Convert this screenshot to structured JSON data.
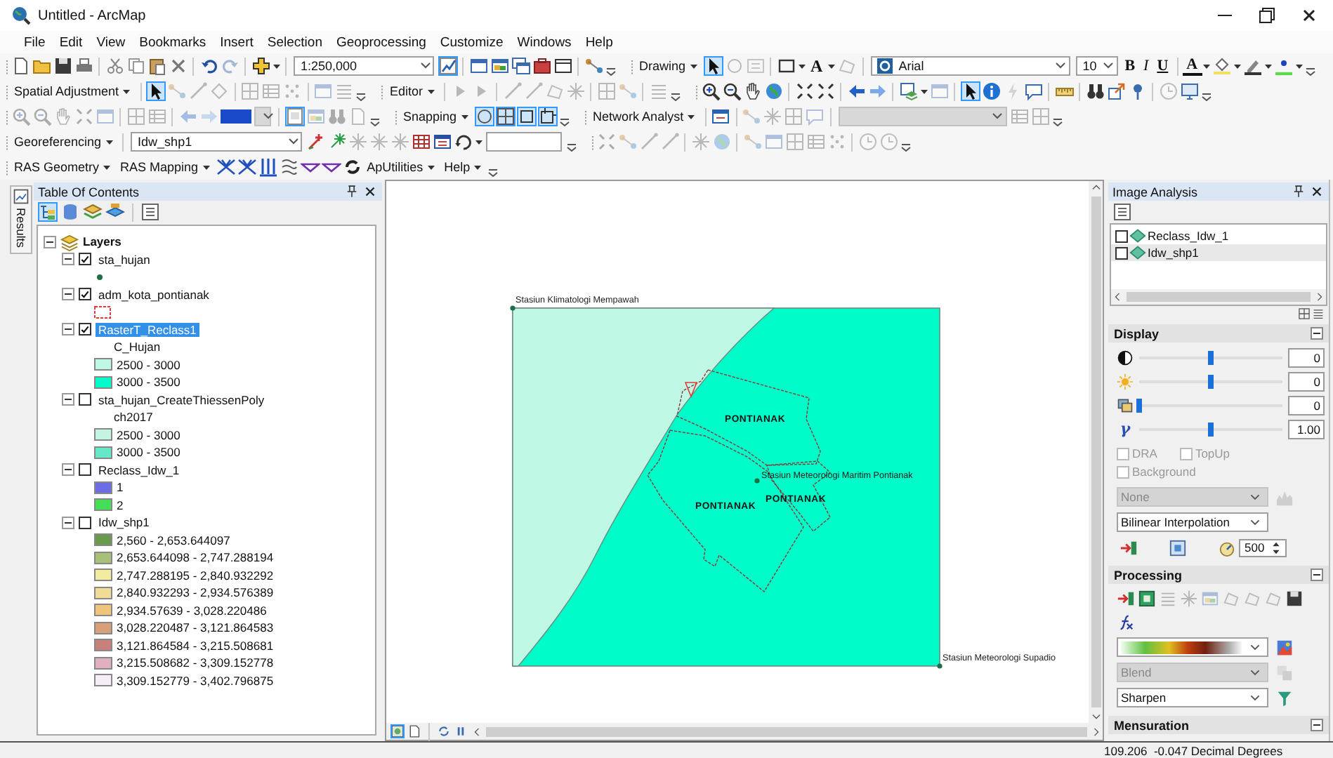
{
  "window": {
    "title": "Untitled - ArcMap"
  },
  "menu": [
    "File",
    "Edit",
    "View",
    "Bookmarks",
    "Insert",
    "Selection",
    "Geoprocessing",
    "Customize",
    "Windows",
    "Help"
  ],
  "toolbar_rows": [
    {
      "items": [
        {
          "kind": "combo",
          "value": "1:250,000"
        },
        {
          "kind": "toggle",
          "selected": true
        },
        {
          "kind": "menu",
          "label": "Drawing"
        },
        {
          "kind": "toggle",
          "selected": true
        },
        {
          "kind": "text_button",
          "label": "A"
        },
        {
          "kind": "combo",
          "value": "Arial"
        },
        {
          "kind": "combo",
          "value": "10"
        },
        {
          "kind": "text_button",
          "label": "B"
        },
        {
          "kind": "text_button",
          "label": "I"
        },
        {
          "kind": "text_button",
          "label": "U"
        },
        {
          "kind": "text_button",
          "label": "A"
        }
      ]
    },
    {
      "items": [
        {
          "kind": "menu",
          "label": "Spatial Adjustment"
        },
        {
          "kind": "toggle",
          "selected": true
        },
        {
          "kind": "menu",
          "label": "Editor"
        },
        {
          "kind": "toggle",
          "selected": true
        }
      ]
    },
    {
      "items": [
        {
          "kind": "combo",
          "disabled": true
        },
        {
          "kind": "toggle",
          "selected": true
        },
        {
          "kind": "menu",
          "label": "Snapping"
        },
        {
          "kind": "toggle",
          "selected": true
        },
        {
          "kind": "toggle",
          "selected": true
        },
        {
          "kind": "toggle",
          "selected": true
        },
        {
          "kind": "toggle",
          "selected": true
        },
        {
          "kind": "menu",
          "label": "Network Analyst"
        },
        {
          "kind": "combo",
          "disabled": true
        }
      ]
    },
    {
      "items": [
        {
          "kind": "menu",
          "label": "Georeferencing"
        },
        {
          "kind": "combo",
          "value": "Idw_shp1"
        },
        {
          "kind": "field"
        }
      ]
    },
    {
      "items": [
        {
          "kind": "menu",
          "label": "RAS Geometry"
        },
        {
          "kind": "menu",
          "label": "RAS Mapping"
        },
        {
          "kind": "menu",
          "label": "ApUtilities"
        },
        {
          "kind": "menu",
          "label": "Help"
        }
      ]
    }
  ],
  "side_tabs": [
    {
      "label": "Results"
    }
  ],
  "toc": {
    "title": "Table Of Contents",
    "views": [
      {
        "selected": true
      },
      {
        "selected": false
      },
      {
        "selected": false
      },
      {
        "selected": false
      }
    ],
    "root": {
      "label": "Layers",
      "expanded": true,
      "children": [
        {
          "label": "sta_hujan",
          "checked": true,
          "expanded": true,
          "selected": false,
          "symbol": {
            "kind": "point",
            "color": "#1e6e46"
          }
        },
        {
          "label": "adm_kota_pontianak",
          "checked": true,
          "expanded": true,
          "selected": false,
          "symbol": {
            "kind": "outline",
            "color": "#e03a3a"
          }
        },
        {
          "label": "RasterT_Reclass1",
          "checked": true,
          "expanded": true,
          "selected": true,
          "field": "C_Hujan",
          "classes": [
            {
              "label": "2500 - 3000",
              "color": "#bff8e4"
            },
            {
              "label": "3000 - 3500",
              "color": "#00fcc8"
            }
          ]
        },
        {
          "label": "sta_hujan_CreateThiessenPoly",
          "checked": false,
          "expanded": true,
          "selected": false,
          "field": "ch2017",
          "classes": [
            {
              "label": "2500 - 3000",
              "color": "#c4f4e2"
            },
            {
              "label": "3000 - 3500",
              "color": "#66e8c8"
            }
          ]
        },
        {
          "label": "Reclass_Idw_1",
          "checked": false,
          "expanded": true,
          "selected": false,
          "classes": [
            {
              "label": "1",
              "color": "#6c6ce4"
            },
            {
              "label": "2",
              "color": "#44dd55"
            }
          ]
        },
        {
          "label": "Idw_shp1",
          "checked": false,
          "expanded": true,
          "selected": false,
          "classes": [
            {
              "label": "2,560 - 2,653.644097",
              "color": "#6a9a4c"
            },
            {
              "label": "2,653.644098 - 2,747.288194",
              "color": "#a8c078"
            },
            {
              "label": "2,747.288195 - 2,840.932292",
              "color": "#f2eca0"
            },
            {
              "label": "2,840.932293 - 2,934.576389",
              "color": "#f0dc98"
            },
            {
              "label": "2,934.57639 - 3,028.220486",
              "color": "#f0c47c"
            },
            {
              "label": "3,028.220487 - 3,121.864583",
              "color": "#d8a078"
            },
            {
              "label": "3,121.864584 - 3,215.508681",
              "color": "#c8807a"
            },
            {
              "label": "3,215.508682 - 3,309.152778",
              "color": "#e0b0c0"
            },
            {
              "label": "3,309.152779 - 3,402.796875",
              "color": "#f6eef6"
            }
          ]
        }
      ]
    }
  },
  "map": {
    "labels": [
      {
        "kind": "station",
        "text": "Stasiun Klimatologi Mempawah"
      },
      {
        "kind": "area",
        "text": "PONTIANAK"
      },
      {
        "kind": "station",
        "text": "Stasiun Meteorologi Maritim Pontianak"
      },
      {
        "kind": "area",
        "text": "PONTIANAK"
      },
      {
        "kind": "area",
        "text": "PONTIANAK"
      },
      {
        "kind": "station",
        "text": "Stasiun Meteorologi Supadio"
      }
    ],
    "views": [
      {
        "selected": true
      },
      {
        "selected": false
      }
    ]
  },
  "image_analysis": {
    "title": "Image Analysis",
    "layers": [
      {
        "label": "Reclass_Idw_1",
        "checked": false,
        "selected": false
      },
      {
        "label": "Idw_shp1",
        "checked": false,
        "selected": true
      }
    ],
    "display": {
      "title": "Display",
      "expanded": true,
      "sliders": [
        {
          "kind": "contrast",
          "level": 0.5,
          "value": "0"
        },
        {
          "kind": "brightness",
          "level": 0.5,
          "value": "0"
        },
        {
          "kind": "transparency",
          "level": 0,
          "value": "0"
        },
        {
          "kind": "gamma",
          "symbol": "γ",
          "level": 0.5,
          "value": "1.00"
        }
      ],
      "checkboxes": [
        {
          "label": "DRA",
          "checked": false,
          "disabled": true
        },
        {
          "label": "TopUp",
          "checked": false,
          "disabled": true
        },
        {
          "label": "Background",
          "checked": false,
          "disabled": true
        }
      ],
      "stretch": {
        "value": "None",
        "disabled": true
      },
      "resampling": {
        "value": "Bilinear Interpolation",
        "disabled": false
      },
      "refresh_value": "500"
    },
    "processing": {
      "title": "Processing",
      "expanded": true,
      "blend": {
        "value": "Blend",
        "disabled": true
      },
      "filter": {
        "value": "Sharpen",
        "disabled": false
      }
    },
    "mensuration": {
      "title": "Mensuration",
      "expanded": true
    }
  },
  "status_bar": {
    "coordinates": "109.206  -0.047 Decimal Degrees"
  }
}
